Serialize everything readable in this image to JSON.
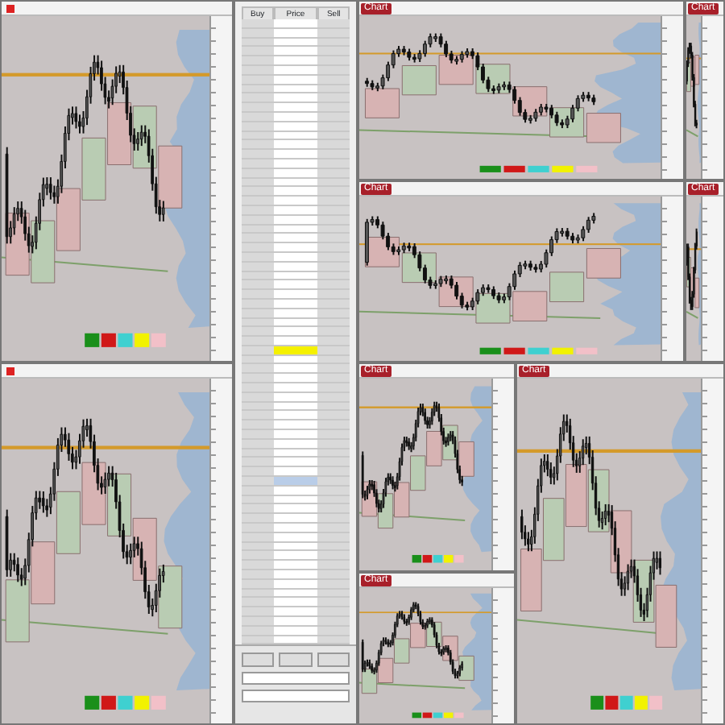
{
  "windows": [
    {
      "kind": "chart"
    },
    {
      "kind": "chart"
    },
    {
      "kind": "chart",
      "button": "Chart"
    },
    {
      "kind": "chart",
      "button": "Chart"
    },
    {
      "kind": "chart",
      "button": "Chart"
    },
    {
      "kind": "chart",
      "button": "Chart"
    },
    {
      "kind": "chart",
      "button": "Chart"
    },
    {
      "kind": "chart",
      "button": "Chart"
    },
    {
      "kind": "chart",
      "button": "Chart"
    }
  ],
  "ladder": {
    "columns": [
      "Buy",
      "Price",
      "Sell"
    ],
    "rows": [
      {
        "kind": "plain"
      },
      {
        "kind": "plain"
      },
      {
        "kind": "plain"
      },
      {
        "kind": "plain"
      },
      {
        "kind": "plain"
      },
      {
        "kind": "plain"
      },
      {
        "kind": "plain"
      },
      {
        "kind": "plain"
      },
      {
        "kind": "plain"
      },
      {
        "kind": "plain"
      },
      {
        "kind": "plain"
      },
      {
        "kind": "plain"
      },
      {
        "kind": "plain"
      },
      {
        "kind": "plain"
      },
      {
        "kind": "plain"
      },
      {
        "kind": "plain"
      },
      {
        "kind": "plain"
      },
      {
        "kind": "plain"
      },
      {
        "kind": "plain"
      },
      {
        "kind": "plain"
      },
      {
        "kind": "plain"
      },
      {
        "kind": "plain"
      },
      {
        "kind": "plain"
      },
      {
        "kind": "plain"
      },
      {
        "kind": "plain"
      },
      {
        "kind": "plain"
      },
      {
        "kind": "plain"
      },
      {
        "kind": "plain"
      },
      {
        "kind": "plain"
      },
      {
        "kind": "plain"
      },
      {
        "kind": "plain"
      },
      {
        "kind": "plain"
      },
      {
        "kind": "plain"
      },
      {
        "kind": "plain"
      },
      {
        "kind": "plain"
      },
      {
        "kind": "last"
      },
      {
        "kind": "plain"
      },
      {
        "kind": "plain"
      },
      {
        "kind": "plain"
      },
      {
        "kind": "plain"
      },
      {
        "kind": "plain"
      },
      {
        "kind": "plain"
      },
      {
        "kind": "plain"
      },
      {
        "kind": "plain"
      },
      {
        "kind": "plain"
      },
      {
        "kind": "plain"
      },
      {
        "kind": "plain"
      },
      {
        "kind": "plain"
      },
      {
        "kind": "plain"
      },
      {
        "kind": "selected"
      },
      {
        "kind": "plain"
      },
      {
        "kind": "plain"
      },
      {
        "kind": "plain"
      },
      {
        "kind": "plain"
      },
      {
        "kind": "plain"
      },
      {
        "kind": "plain"
      },
      {
        "kind": "plain"
      },
      {
        "kind": "plain"
      },
      {
        "kind": "plain"
      },
      {
        "kind": "plain"
      },
      {
        "kind": "plain"
      },
      {
        "kind": "plain"
      },
      {
        "kind": "plain"
      },
      {
        "kind": "plain"
      },
      {
        "kind": "plain"
      },
      {
        "kind": "plain"
      },
      {
        "kind": "plain"
      }
    ]
  }
}
